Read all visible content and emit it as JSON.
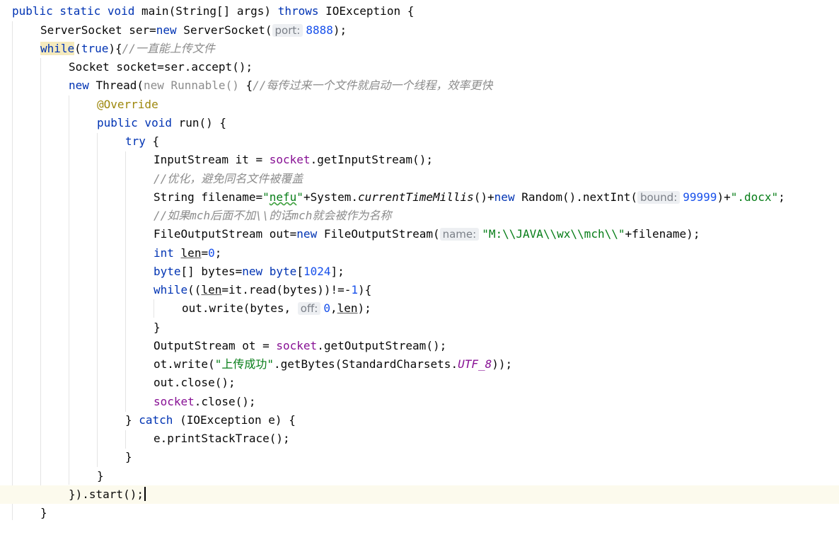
{
  "editor": {
    "l1": {
      "kw1": "public static void ",
      "method": "main",
      "p1": "(String[] args) ",
      "kw2": "throws",
      "p2": " IOException {"
    },
    "l2": {
      "p1": "ServerSocket ser=",
      "kw1": "new",
      "p2": " ServerSocket(",
      "hint": "port:",
      "num": "8888",
      "p3": ");"
    },
    "l3": {
      "kw1": "while",
      "p1": "(",
      "kw2": "true",
      "p2": "){",
      "comment": "//一直能上传文件"
    },
    "l4": {
      "p1": "Socket socket=ser.accept();"
    },
    "l5": {
      "kw1": "new",
      "p1": " Thread(",
      "grey": "new Runnable() ",
      "p2": "{",
      "comment": "//每传过来一个文件就启动一个线程，效率更快"
    },
    "l6": {
      "ann": "@Override"
    },
    "l7": {
      "kw1": "public void ",
      "method": "run",
      "p1": "() {"
    },
    "l8": {
      "kw1": "try",
      "p1": " {"
    },
    "l9": {
      "p1": "InputStream it = ",
      "field": "socket",
      "p2": ".getInputStream();"
    },
    "l10": {
      "comment": "//优化，避免同名文件被覆盖"
    },
    "l11": {
      "p1": "String filename=",
      "str1a": "\"",
      "str1typo": "nefu",
      "str1b": "\"",
      "p2": "+System.",
      "italic": "currentTimeMillis",
      "p3": "()+",
      "kw1": "new",
      "p4": " Random().nextInt(",
      "hint": "bound:",
      "num": "99999",
      "p5": ")+",
      "str2": "\".docx\"",
      "p6": ";"
    },
    "l12": {
      "comment": "//如果mch后面不加\\\\的话mch就会被作为名称"
    },
    "l13": {
      "p1": "FileOutputStream out=",
      "kw1": "new",
      "p2": " FileOutputStream(",
      "hint": "name:",
      "str": "\"M:\\\\JAVA\\\\wx\\\\mch\\\\\"",
      "p3": "+filename);"
    },
    "l14": {
      "kw1": "int",
      "p1": " ",
      "var": "len",
      "p2": "=",
      "num": "0",
      "p3": ";"
    },
    "l15": {
      "kw1": "byte",
      "p1": "[] bytes=",
      "kw2": "new",
      "p2": " ",
      "kw3": "byte",
      "p3": "[",
      "num": "1024",
      "p4": "];"
    },
    "l16": {
      "kw1": "while",
      "p1": "((",
      "var": "len",
      "p2": "=it.read(bytes))!=-",
      "num": "1",
      "p3": "){"
    },
    "l17": {
      "p1": "out.write(bytes, ",
      "hint": "off:",
      "num": "0",
      "p2": ",",
      "var": "len",
      "p3": ");"
    },
    "l18": {
      "p1": "}"
    },
    "l19": {
      "p1": "OutputStream ot = ",
      "field": "socket",
      "p2": ".getOutputStream();"
    },
    "l20": {
      "p1": "ot.write(",
      "str": "\"上传成功\"",
      "p2": ".getBytes(StandardCharsets.",
      "sfield": "UTF_8",
      "p3": "));"
    },
    "l21": {
      "p1": "out.close();"
    },
    "l22": {
      "field": "socket",
      "p1": ".close();"
    },
    "l23": {
      "p1": "} ",
      "kw1": "catch",
      "p2": " (IOException e) {"
    },
    "l24": {
      "p1": "e.printStackTrace();"
    },
    "l25": {
      "p1": "}"
    },
    "l26": {
      "p1": "}"
    },
    "l27": {
      "p1": "}).start();"
    },
    "l28": {
      "p1": "}"
    }
  },
  "colors": {
    "keyword": "#0033b3",
    "string": "#067d17",
    "number": "#1750eb",
    "comment": "#8c8c8c",
    "field": "#871094",
    "annotation": "#9e880d",
    "current_line": "#fcfaed"
  }
}
